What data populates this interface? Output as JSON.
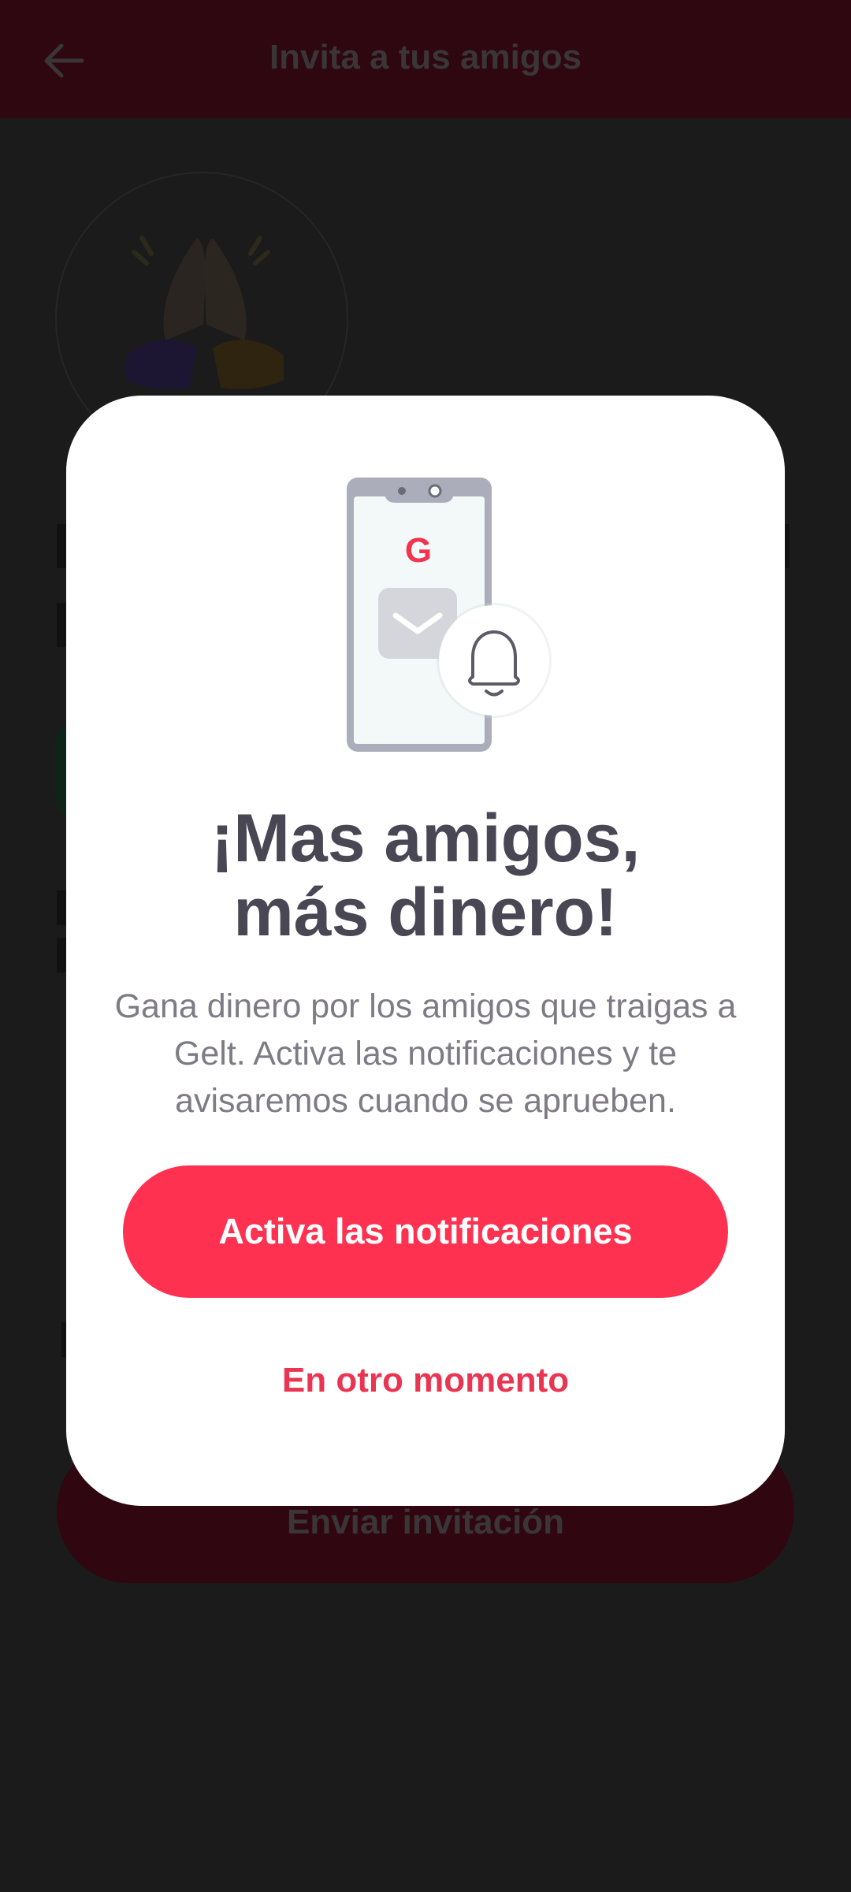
{
  "background_screen": {
    "title": "Invita a tus amigos",
    "send_button_label": "Enviar invitación"
  },
  "modal": {
    "logo_letter": "G",
    "title": "¡Mas amigos,\nmás dinero!",
    "body": "Gana dinero por los amigos que traigas a Gelt. Activa las notificaciones y te avisaremos cuando se aprueben.",
    "primary_button": "Activa las notificaciones",
    "secondary_link": "En otro momento"
  },
  "colors": {
    "accent": "#fe3151",
    "link": "#e93452",
    "title_text": "#4a4754",
    "body_text": "#7e7b85",
    "overlay_bg": "#1b1b1b"
  },
  "icons": [
    "back-arrow-icon",
    "high-five-hands-icon",
    "phone-icon",
    "mail-icon",
    "bell-icon"
  ]
}
